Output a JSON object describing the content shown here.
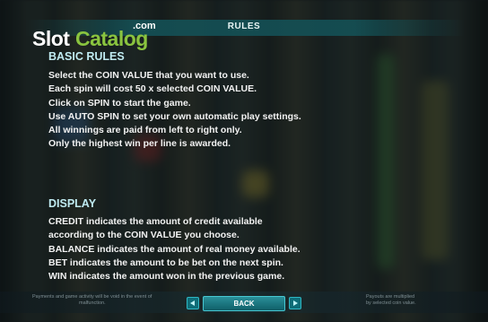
{
  "header": {
    "title": "RULES",
    "logo": {
      "part1": "Slot",
      "part2": "Catalog",
      "suffix": ".com"
    }
  },
  "basic_rules": {
    "title": "BASIC RULES",
    "items": [
      "Select the COIN VALUE that you want to use.",
      "Each spin will cost 50 x selected COIN VALUE.",
      "Click on SPIN to start the game.",
      "Use AUTO SPIN to set your own automatic play settings.",
      "All winnings are paid from left to right only.",
      "Only the highest win per line is awarded."
    ]
  },
  "display": {
    "title": "DISPLAY",
    "items": [
      "CREDIT indicates the amount of credit available",
      "according to the COIN VALUE you choose.",
      "BALANCE indicates the amount of real money available.",
      "BET indicates the amount to be bet on the next spin.",
      "WIN indicates the amount won in the previous game."
    ]
  },
  "footer": {
    "left_note_line1": "Payments and game activity will be void in the event of",
    "left_note_line2": "malfunction.",
    "right_note_line1": "Payouts are multiplied",
    "right_note_line2": "by selected coin value.",
    "back_label": "BACK",
    "prev_icon": "triangle-left-icon",
    "next_icon": "triangle-right-icon"
  },
  "colors": {
    "accent": "#2fb7c4",
    "logo_green": "#8ac43f",
    "section_title": "#bfeaf0"
  }
}
